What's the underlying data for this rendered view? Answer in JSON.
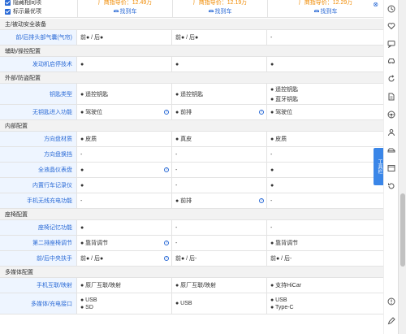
{
  "options": [
    "隐藏相同项",
    "标示最优项"
  ],
  "columns": [
    {
      "price": "厂商指导价：12.49万",
      "dealer": "找到车"
    },
    {
      "price": "厂商指导价：12.19万",
      "dealer": "找到车"
    },
    {
      "price": "厂商指导价：12.29万",
      "dealer": "找到车"
    }
  ],
  "close_glyph": "⊗",
  "info_glyph": "?",
  "tool_tab": "工具栏",
  "rows": [
    {
      "type": "section",
      "title": "主/被动安全装备"
    },
    {
      "type": "data",
      "label": "前/后排头部气囊(气帘)",
      "cells": [
        [
          "前● / 后●"
        ],
        [
          "前● / 后●"
        ],
        [
          "-"
        ]
      ],
      "info": []
    },
    {
      "type": "section",
      "title": "辅助/操控配置"
    },
    {
      "type": "data",
      "label": "发动机启停技术",
      "cells": [
        [
          "●"
        ],
        [
          "●"
        ],
        [
          "●"
        ]
      ],
      "info": []
    },
    {
      "type": "section",
      "title": "外部/防盗配置"
    },
    {
      "type": "data",
      "label": "钥匙类型",
      "cells": [
        [
          "● 遥控钥匙"
        ],
        [
          "● 遥控钥匙"
        ],
        [
          "● 遥控钥匙",
          "● 蓝牙钥匙"
        ]
      ],
      "info": []
    },
    {
      "type": "data",
      "label": "无钥匙进入功能",
      "cells": [
        [
          "● 驾驶位"
        ],
        [
          "● 前排"
        ],
        [
          "● 驾驶位"
        ]
      ],
      "info": [
        0,
        1
      ]
    },
    {
      "type": "section",
      "title": "内部配置"
    },
    {
      "type": "data",
      "label": "方向盘材质",
      "cells": [
        [
          "● 皮质"
        ],
        [
          "● 真皮"
        ],
        [
          "● 皮质"
        ]
      ],
      "info": []
    },
    {
      "type": "data",
      "label": "方向盘换挡",
      "cells": [
        [
          "-"
        ],
        [
          "-"
        ],
        [
          "-"
        ]
      ],
      "info": []
    },
    {
      "type": "data",
      "label": "全液晶仪表盘",
      "cells": [
        [
          "●"
        ],
        [
          "-"
        ],
        [
          "●"
        ]
      ],
      "info": [
        0
      ]
    },
    {
      "type": "data",
      "label": "内置行车记录仪",
      "cells": [
        [
          "●"
        ],
        [
          "-"
        ],
        [
          "●"
        ]
      ],
      "info": []
    },
    {
      "type": "data",
      "label": "手机无线充电功能",
      "cells": [
        [
          "-"
        ],
        [
          "● 前排"
        ],
        [
          "-"
        ]
      ],
      "info": [
        1
      ]
    },
    {
      "type": "section",
      "title": "座椅配置"
    },
    {
      "type": "data",
      "label": "座椅记忆功能",
      "cells": [
        [
          "●"
        ],
        [
          "-"
        ],
        [
          "-"
        ]
      ],
      "info": []
    },
    {
      "type": "data",
      "label": "第二排座椅调节",
      "cells": [
        [
          "● 靠背调节"
        ],
        [
          "-"
        ],
        [
          "● 靠背调节"
        ]
      ],
      "info": [
        0
      ]
    },
    {
      "type": "data",
      "label": "前/后中央扶手",
      "cells": [
        [
          "前● / 后●"
        ],
        [
          "前● / 后-"
        ],
        [
          "前● / 后-"
        ]
      ],
      "info": [
        0
      ]
    },
    {
      "type": "section",
      "title": "多媒体配置"
    },
    {
      "type": "data",
      "label": "手机互联/映射",
      "cells": [
        [
          "● 原厂互联/映射"
        ],
        [
          "● 原厂互联/映射"
        ],
        [
          "● 支持HiCar"
        ]
      ],
      "info": []
    },
    {
      "type": "data",
      "label": "多媒体/充电接口",
      "cells": [
        [
          "● USB",
          "● SD"
        ],
        [
          "● USB"
        ],
        [
          "● USB",
          "● Type-C"
        ]
      ],
      "info": []
    }
  ],
  "toolbar_icons": [
    "clock-icon",
    "heart-icon",
    "chat-icon",
    "car-icon",
    "refresh-icon",
    "document-icon",
    "steering-wheel-icon",
    "user-icon",
    "car-side-icon",
    "window-icon",
    "history-icon",
    "alert-icon",
    "edit-icon"
  ]
}
